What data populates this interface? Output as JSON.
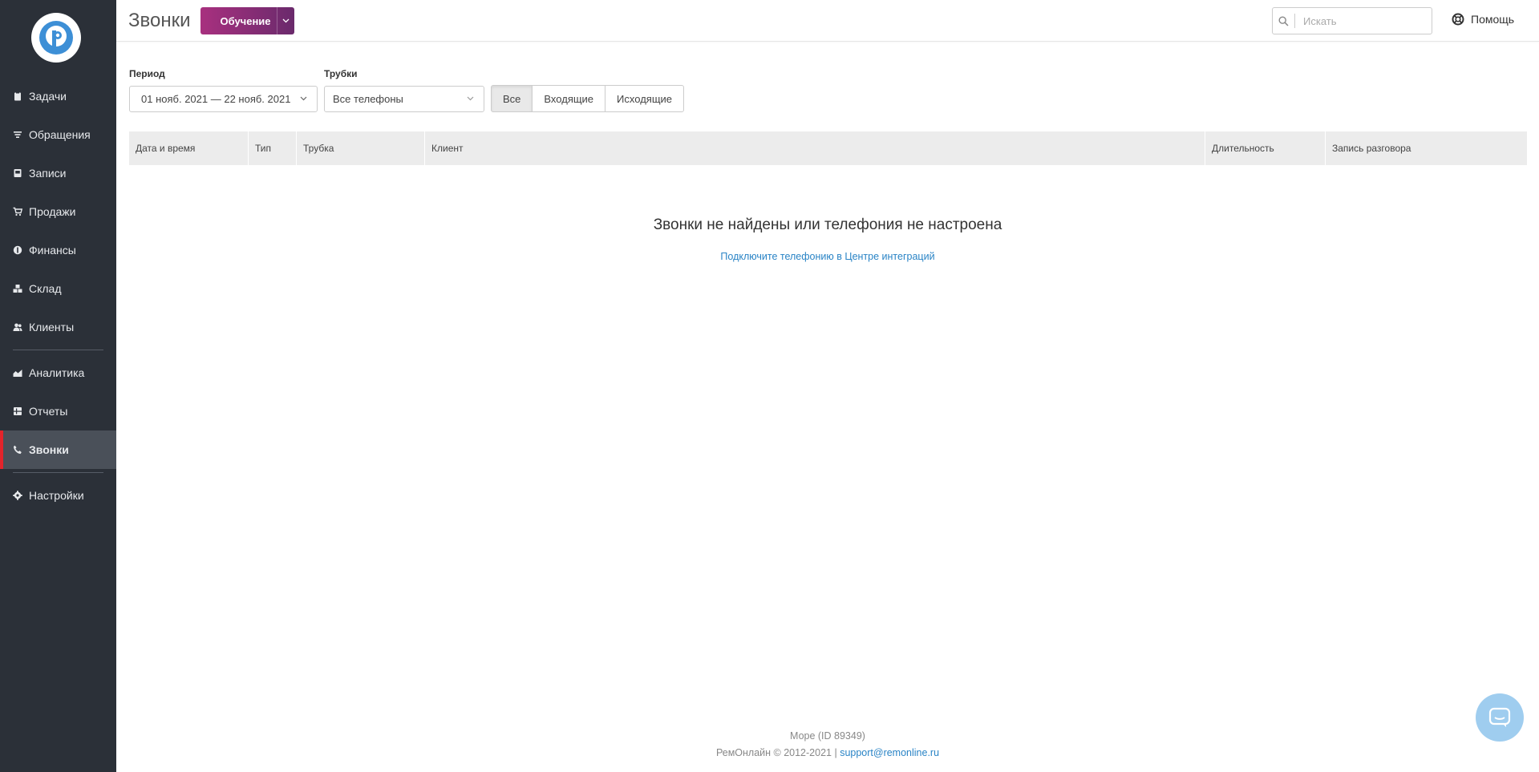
{
  "sidebar": {
    "items": [
      {
        "label": "Задачи",
        "icon": "clipboard-icon"
      },
      {
        "label": "Обращения",
        "icon": "filter-icon"
      },
      {
        "label": "Записи",
        "icon": "book-icon"
      },
      {
        "label": "Продажи",
        "icon": "cart-icon"
      },
      {
        "label": "Финансы",
        "icon": "coin-icon"
      },
      {
        "label": "Склад",
        "icon": "boxes-icon"
      },
      {
        "label": "Клиенты",
        "icon": "users-icon"
      },
      {
        "label": "Аналитика",
        "icon": "chart-icon"
      },
      {
        "label": "Отчеты",
        "icon": "report-icon"
      },
      {
        "label": "Звонки",
        "icon": "phone-icon",
        "active": true
      },
      {
        "label": "Настройки",
        "icon": "gear-icon"
      }
    ],
    "accent_color": "#e3242b"
  },
  "header": {
    "title": "Звонки",
    "training_label": "Обучение",
    "search_placeholder": "Искать",
    "help_label": "Помощь"
  },
  "filters": {
    "period_label": "Период",
    "period_value": "01 нояб. 2021 — 22 нояб. 2021",
    "phones_label": "Трубки",
    "phones_value": "Все телефоны",
    "segments": [
      "Все",
      "Входящие",
      "Исходящие"
    ],
    "segment_selected": "Все"
  },
  "table": {
    "columns": [
      "Дата и время",
      "Тип",
      "Трубка",
      "Клиент",
      "Длительность",
      "Запись разговора"
    ],
    "rows": []
  },
  "empty_state": {
    "title": "Звонки не найдены или телефония не настроена",
    "link": "Подключите телефонию в Центре интеграций"
  },
  "footer": {
    "company": "Море (ID 89349)",
    "copyright": "РемОнлайн © 2012-2021 |",
    "support_email": "support@remonline.ru"
  }
}
